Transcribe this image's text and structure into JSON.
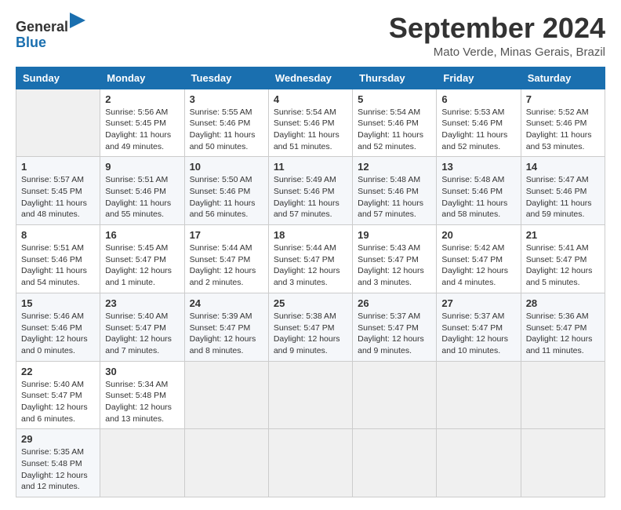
{
  "header": {
    "logo": {
      "text_general": "General",
      "text_blue": "Blue",
      "arrow_color": "#1a6faf"
    },
    "title": "September 2024",
    "location": "Mato Verde, Minas Gerais, Brazil"
  },
  "calendar": {
    "days_of_week": [
      "Sunday",
      "Monday",
      "Tuesday",
      "Wednesday",
      "Thursday",
      "Friday",
      "Saturday"
    ],
    "weeks": [
      [
        {
          "day": "",
          "info": ""
        },
        {
          "day": "2",
          "info": "Sunrise: 5:56 AM\nSunset: 5:45 PM\nDaylight: 11 hours\nand 49 minutes."
        },
        {
          "day": "3",
          "info": "Sunrise: 5:55 AM\nSunset: 5:46 PM\nDaylight: 11 hours\nand 50 minutes."
        },
        {
          "day": "4",
          "info": "Sunrise: 5:54 AM\nSunset: 5:46 PM\nDaylight: 11 hours\nand 51 minutes."
        },
        {
          "day": "5",
          "info": "Sunrise: 5:54 AM\nSunset: 5:46 PM\nDaylight: 11 hours\nand 52 minutes."
        },
        {
          "day": "6",
          "info": "Sunrise: 5:53 AM\nSunset: 5:46 PM\nDaylight: 11 hours\nand 52 minutes."
        },
        {
          "day": "7",
          "info": "Sunrise: 5:52 AM\nSunset: 5:46 PM\nDaylight: 11 hours\nand 53 minutes."
        }
      ],
      [
        {
          "day": "1",
          "info": "Sunrise: 5:57 AM\nSunset: 5:45 PM\nDaylight: 11 hours\nand 48 minutes."
        },
        {
          "day": "9",
          "info": "Sunrise: 5:51 AM\nSunset: 5:46 PM\nDaylight: 11 hours\nand 55 minutes."
        },
        {
          "day": "10",
          "info": "Sunrise: 5:50 AM\nSunset: 5:46 PM\nDaylight: 11 hours\nand 56 minutes."
        },
        {
          "day": "11",
          "info": "Sunrise: 5:49 AM\nSunset: 5:46 PM\nDaylight: 11 hours\nand 57 minutes."
        },
        {
          "day": "12",
          "info": "Sunrise: 5:48 AM\nSunset: 5:46 PM\nDaylight: 11 hours\nand 57 minutes."
        },
        {
          "day": "13",
          "info": "Sunrise: 5:48 AM\nSunset: 5:46 PM\nDaylight: 11 hours\nand 58 minutes."
        },
        {
          "day": "14",
          "info": "Sunrise: 5:47 AM\nSunset: 5:46 PM\nDaylight: 11 hours\nand 59 minutes."
        }
      ],
      [
        {
          "day": "8",
          "info": "Sunrise: 5:51 AM\nSunset: 5:46 PM\nDaylight: 11 hours\nand 54 minutes."
        },
        {
          "day": "16",
          "info": "Sunrise: 5:45 AM\nSunset: 5:47 PM\nDaylight: 12 hours\nand 1 minute."
        },
        {
          "day": "17",
          "info": "Sunrise: 5:44 AM\nSunset: 5:47 PM\nDaylight: 12 hours\nand 2 minutes."
        },
        {
          "day": "18",
          "info": "Sunrise: 5:44 AM\nSunset: 5:47 PM\nDaylight: 12 hours\nand 3 minutes."
        },
        {
          "day": "19",
          "info": "Sunrise: 5:43 AM\nSunset: 5:47 PM\nDaylight: 12 hours\nand 3 minutes."
        },
        {
          "day": "20",
          "info": "Sunrise: 5:42 AM\nSunset: 5:47 PM\nDaylight: 12 hours\nand 4 minutes."
        },
        {
          "day": "21",
          "info": "Sunrise: 5:41 AM\nSunset: 5:47 PM\nDaylight: 12 hours\nand 5 minutes."
        }
      ],
      [
        {
          "day": "15",
          "info": "Sunrise: 5:46 AM\nSunset: 5:46 PM\nDaylight: 12 hours\nand 0 minutes."
        },
        {
          "day": "23",
          "info": "Sunrise: 5:40 AM\nSunset: 5:47 PM\nDaylight: 12 hours\nand 7 minutes."
        },
        {
          "day": "24",
          "info": "Sunrise: 5:39 AM\nSunset: 5:47 PM\nDaylight: 12 hours\nand 8 minutes."
        },
        {
          "day": "25",
          "info": "Sunrise: 5:38 AM\nSunset: 5:47 PM\nDaylight: 12 hours\nand 9 minutes."
        },
        {
          "day": "26",
          "info": "Sunrise: 5:37 AM\nSunset: 5:47 PM\nDaylight: 12 hours\nand 9 minutes."
        },
        {
          "day": "27",
          "info": "Sunrise: 5:37 AM\nSunset: 5:47 PM\nDaylight: 12 hours\nand 10 minutes."
        },
        {
          "day": "28",
          "info": "Sunrise: 5:36 AM\nSunset: 5:47 PM\nDaylight: 12 hours\nand 11 minutes."
        }
      ],
      [
        {
          "day": "22",
          "info": "Sunrise: 5:40 AM\nSunset: 5:47 PM\nDaylight: 12 hours\nand 6 minutes."
        },
        {
          "day": "30",
          "info": "Sunrise: 5:34 AM\nSunset: 5:48 PM\nDaylight: 12 hours\nand 13 minutes."
        },
        {
          "day": "",
          "info": ""
        },
        {
          "day": "",
          "info": ""
        },
        {
          "day": "",
          "info": ""
        },
        {
          "day": "",
          "info": ""
        },
        {
          "day": "",
          "info": ""
        }
      ],
      [
        {
          "day": "29",
          "info": "Sunrise: 5:35 AM\nSunset: 5:48 PM\nDaylight: 12 hours\nand 12 minutes."
        },
        {
          "day": "",
          "info": ""
        },
        {
          "day": "",
          "info": ""
        },
        {
          "day": "",
          "info": ""
        },
        {
          "day": "",
          "info": ""
        },
        {
          "day": "",
          "info": ""
        },
        {
          "day": "",
          "info": ""
        }
      ]
    ]
  }
}
